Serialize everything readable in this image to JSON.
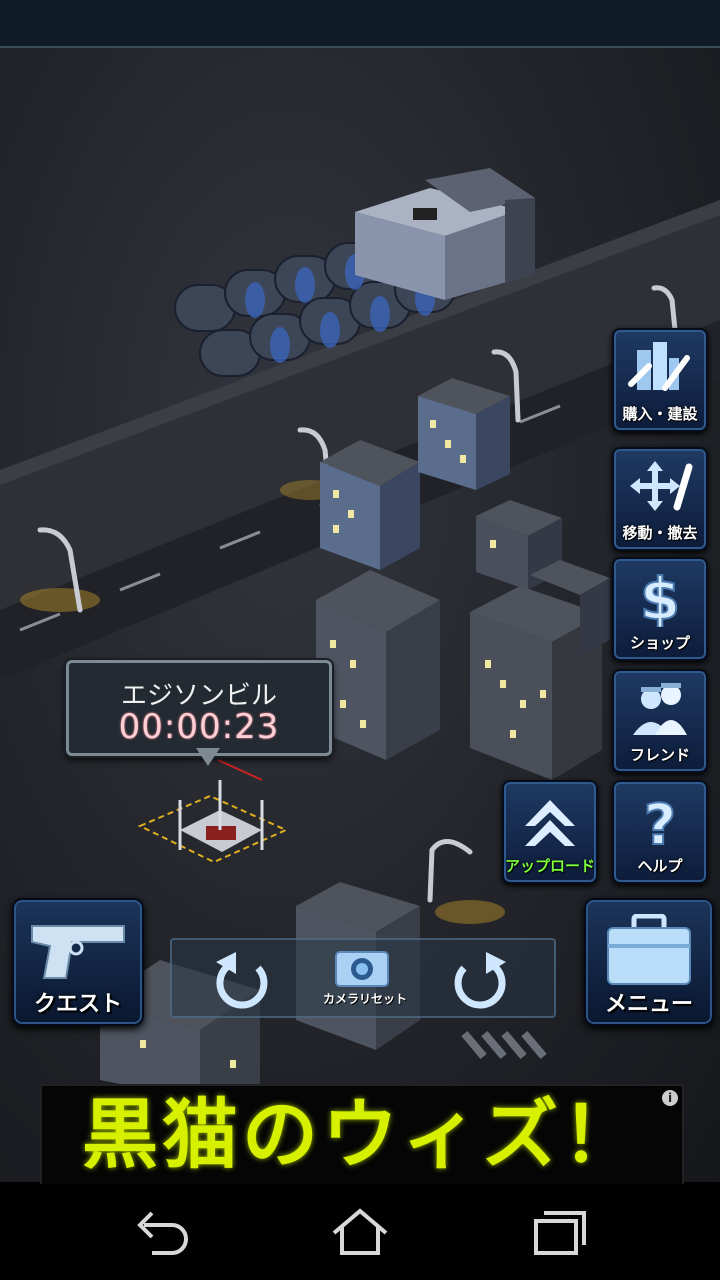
{
  "side_buttons": {
    "buy_build": "購入・建設",
    "move_remove": "移動・撤去",
    "shop": "ショップ",
    "friend": "フレンド",
    "upload": "アップロード",
    "help": "ヘルプ"
  },
  "quest_button": {
    "label": "クエスト"
  },
  "menu_button": {
    "label": "メニュー"
  },
  "camera_bar": {
    "reset_label": "カメラリセット"
  },
  "construction": {
    "building_name": "エジソンビル",
    "remaining_time": "00:00:23"
  },
  "ad": {
    "text": "黒猫のウィズ！",
    "info_icon": "i"
  },
  "colors": {
    "accent_green": "#7dff3a",
    "ad_text": "#d6f000",
    "timer_text": "#ffcfd6"
  }
}
